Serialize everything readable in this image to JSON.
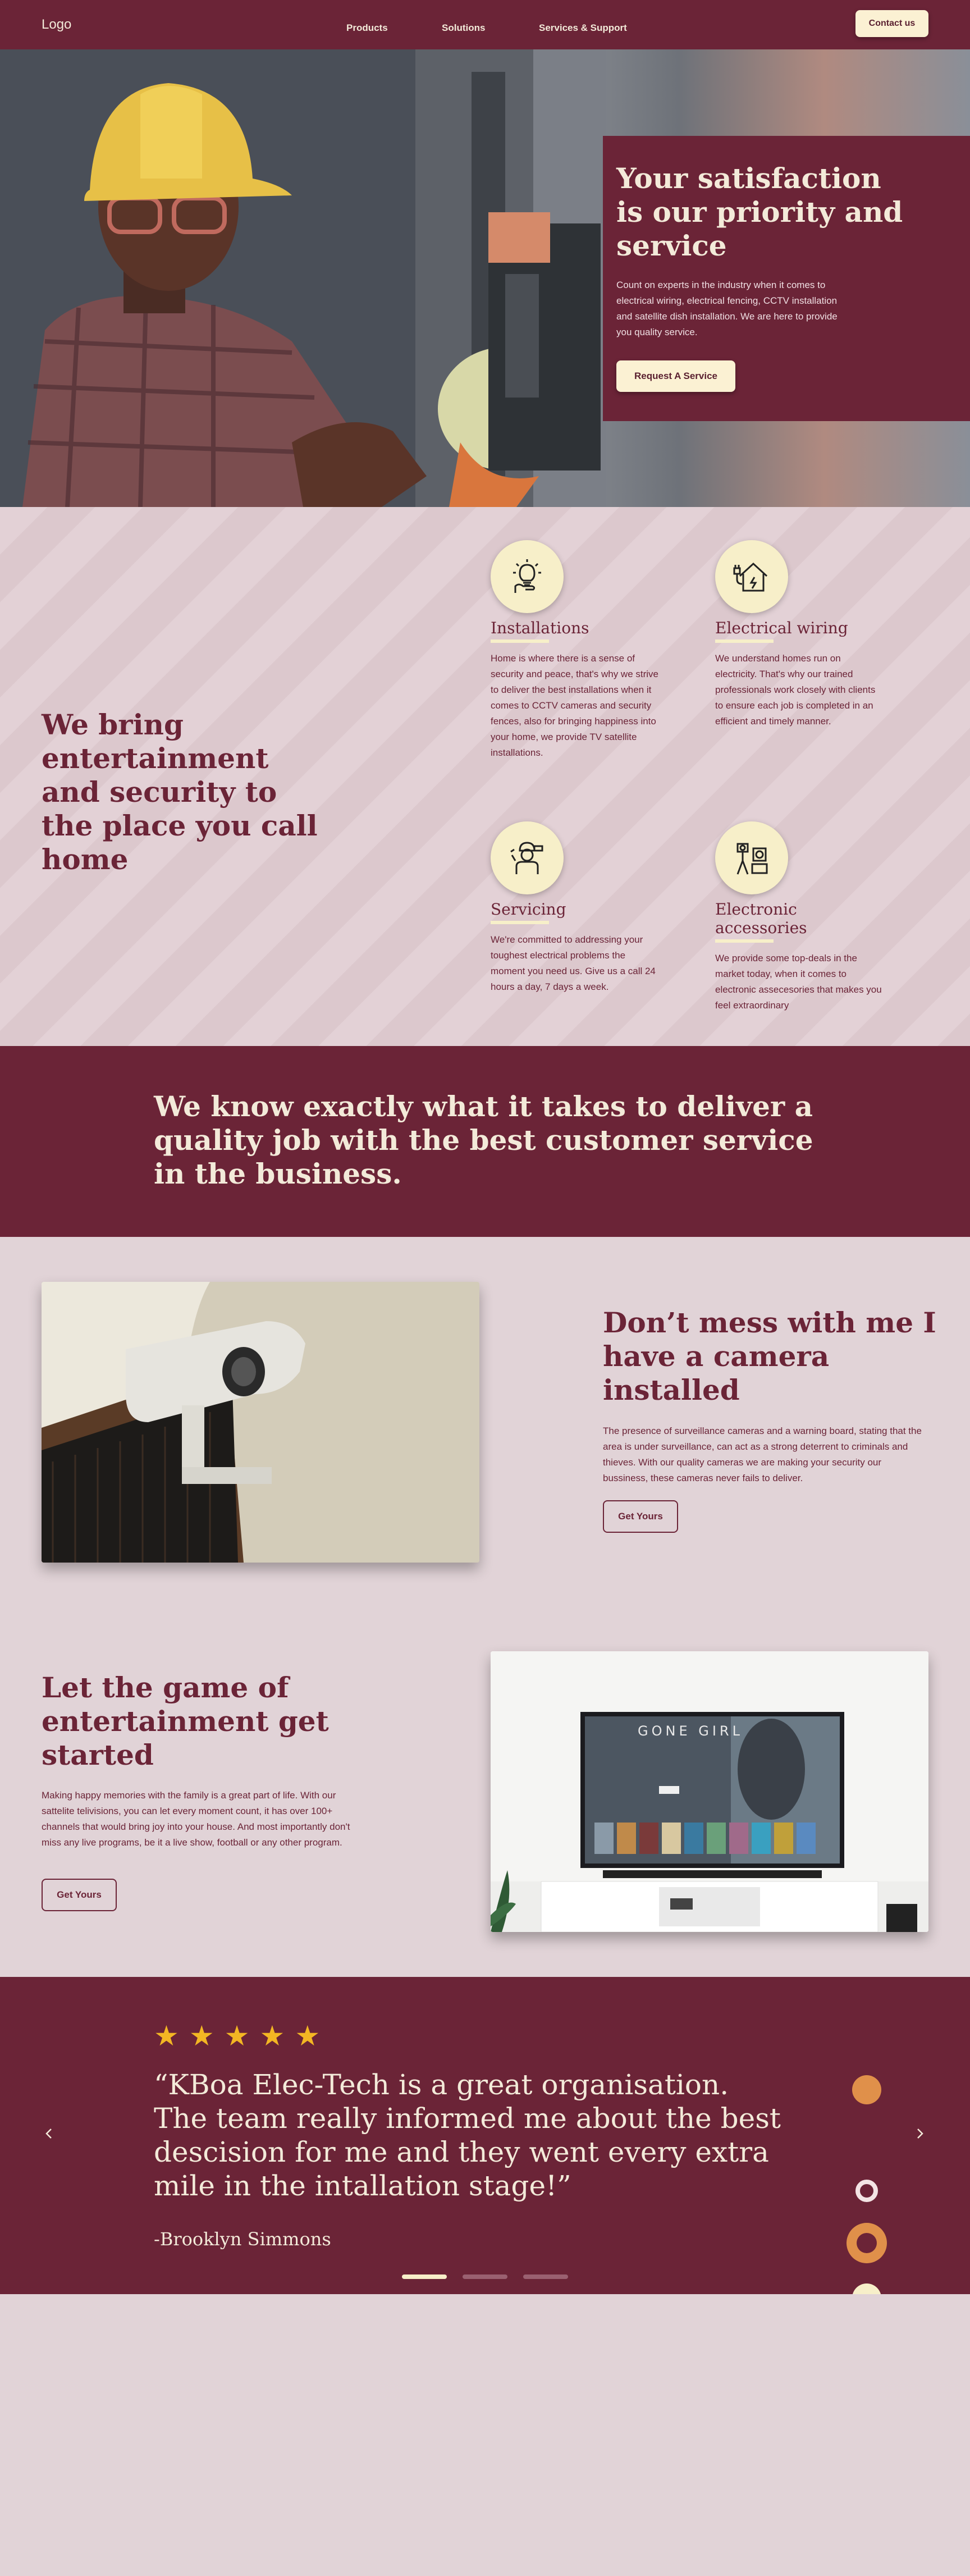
{
  "nav": {
    "logo": "Logo",
    "links": [
      "Products",
      "Solutions",
      "Services & Support"
    ],
    "contact_label": "Contact us"
  },
  "hero": {
    "title": "Your satisfaction is our priority and service",
    "text": "Count on experts in the industry when it comes to electrical wiring, electrical fencing, CCTV installation and satellite dish installation. We are here to provide you quality service.",
    "button_label": "Request A Service"
  },
  "services": {
    "title": "We bring entertainment and security to the place you call home",
    "items": [
      {
        "title": "Installations",
        "icon": "lightbulb-hand-icon",
        "text": "Home is where there is a sense of security and peace, that's why we strive to deliver the best installations when it comes to CCTV cameras and security fences, also for bringing happiness into your home, we provide TV satellite installations."
      },
      {
        "title": "Electrical wiring",
        "icon": "house-plug-icon",
        "text": "We understand homes run on electricity. That's why our trained professionals work closely with clients  to ensure each job is completed in an efficient and timely manner."
      },
      {
        "title": "Servicing",
        "icon": "technician-icon",
        "text": "We're committed to addressing your toughest electrical problems the moment you need us. Give us a call 24 hours a day, 7 days a week."
      },
      {
        "title": "Electronic accessories",
        "icon": "accessories-icon",
        "text": "We provide some top-deals in the market today, when it comes to electronic assecesories that makes you feel extraordinary"
      }
    ]
  },
  "banner": {
    "text": "We know exactly what it takes to deliver a quality job with the best customer service in the business."
  },
  "camera": {
    "title": "Don’t mess with me I have a camera installed",
    "text": "The presence of surveillance cameras and a warning board, stating that the area is under surveillance, can act as a strong deterrent to criminals and thieves. With our quality cameras we are making your security our bussiness, these cameras never fails to deliver.",
    "button_label": "Get Yours"
  },
  "entertainment": {
    "title": "Let the game of entertainment get started",
    "text": "Making happy memories with the family is a great part of life. With our sattelite telivisions, you can let every moment count, it has over 100+ channels that would bring joy into your house. And most importantly don't miss any live programs, be it a live show, football or any other program.",
    "button_label": "Get Yours",
    "tv_screen_title": "GONE GIRL"
  },
  "testimonial": {
    "rating": 5,
    "quote": "“KBoa Elec-Tech is a great organisation. The team really informed me about the best descision for me and they went every extra mile in the intallation stage!”",
    "author": "-Brooklyn Simmons",
    "prev_icon": "chevron-left-icon",
    "next_icon": "chevron-right-icon",
    "slides": 3,
    "active_slide": 1
  },
  "colors": {
    "brand": "#6b2437",
    "cream": "#fbf1d3",
    "page_bg": "#e1d3d7",
    "star": "#f3b623",
    "accent_orange": "#e0904a"
  }
}
